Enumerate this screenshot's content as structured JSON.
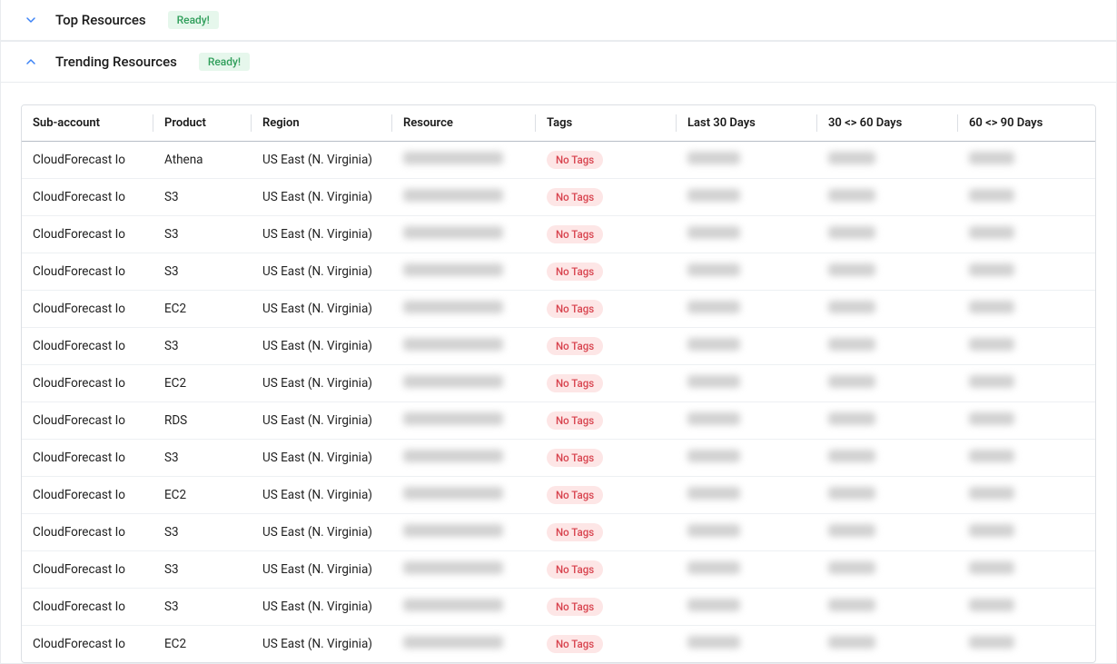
{
  "panels": {
    "top_resources": {
      "title": "Top Resources",
      "badge": "Ready!"
    },
    "trending_resources": {
      "title": "Trending Resources",
      "badge": "Ready!"
    }
  },
  "table": {
    "headers": {
      "subaccount": "Sub-account",
      "product": "Product",
      "region": "Region",
      "resource": "Resource",
      "tags": "Tags",
      "last30": "Last 30 Days",
      "d3060": "30 <> 60 Days",
      "d6090": "60 <> 90 Days"
    },
    "no_tags_label": "No Tags",
    "rows": [
      {
        "subaccount": "CloudForecast Io",
        "product": "Athena",
        "region": "US East (N. Virginia)",
        "tags": "none"
      },
      {
        "subaccount": "CloudForecast Io",
        "product": "S3",
        "region": "US East (N. Virginia)",
        "tags": "none"
      },
      {
        "subaccount": "CloudForecast Io",
        "product": "S3",
        "region": "US East (N. Virginia)",
        "tags": "none"
      },
      {
        "subaccount": "CloudForecast Io",
        "product": "S3",
        "region": "US East (N. Virginia)",
        "tags": "none"
      },
      {
        "subaccount": "CloudForecast Io",
        "product": "EC2",
        "region": "US East (N. Virginia)",
        "tags": "none"
      },
      {
        "subaccount": "CloudForecast Io",
        "product": "S3",
        "region": "US East (N. Virginia)",
        "tags": "none"
      },
      {
        "subaccount": "CloudForecast Io",
        "product": "EC2",
        "region": "US East (N. Virginia)",
        "tags": "none"
      },
      {
        "subaccount": "CloudForecast Io",
        "product": "RDS",
        "region": "US East (N. Virginia)",
        "tags": "none"
      },
      {
        "subaccount": "CloudForecast Io",
        "product": "S3",
        "region": "US East (N. Virginia)",
        "tags": "none"
      },
      {
        "subaccount": "CloudForecast Io",
        "product": "EC2",
        "region": "US East (N. Virginia)",
        "tags": "none"
      },
      {
        "subaccount": "CloudForecast Io",
        "product": "S3",
        "region": "US East (N. Virginia)",
        "tags": "none"
      },
      {
        "subaccount": "CloudForecast Io",
        "product": "S3",
        "region": "US East (N. Virginia)",
        "tags": "none"
      },
      {
        "subaccount": "CloudForecast Io",
        "product": "S3",
        "region": "US East (N. Virginia)",
        "tags": "none"
      },
      {
        "subaccount": "CloudForecast Io",
        "product": "EC2",
        "region": "US East (N. Virginia)",
        "tags": "none"
      }
    ]
  }
}
